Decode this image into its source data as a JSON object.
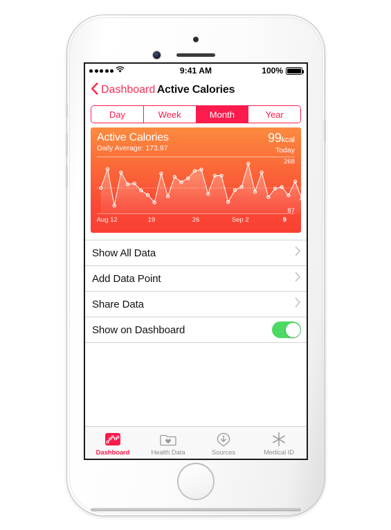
{
  "status_bar": {
    "signal_dots": 5,
    "wifi_icon": "wifi-icon",
    "time": "9:41 AM",
    "battery_percent": "100%"
  },
  "nav": {
    "back_label": "Dashboard",
    "back_icon": "chevron-left-icon",
    "title": "Active Calories"
  },
  "segmented": {
    "options": [
      "Day",
      "Week",
      "Month",
      "Year"
    ],
    "selected": "Month",
    "accent": "#fb1b4c"
  },
  "card": {
    "title": "Active Calories",
    "subtitle": "Daily Average: 173.97",
    "value": "99",
    "unit": "kcal",
    "period": "Today",
    "max_label": "268",
    "min_label": "87",
    "gradient_from": "#fb8b3f",
    "gradient_to": "#fa3f33"
  },
  "chart_data": {
    "type": "line",
    "title": "Active Calories",
    "subtitle": "Daily Average: 173.97",
    "ylabel": "kcal",
    "xlabel": "",
    "ylim": [
      87,
      268
    ],
    "grid": false,
    "legend": null,
    "average_line": 173.97,
    "axis_ticks": [
      {
        "label": "Aug 12",
        "index": 1,
        "bold": false
      },
      {
        "label": "19",
        "index": 8,
        "bold": false
      },
      {
        "label": "26",
        "index": 15,
        "bold": false
      },
      {
        "label": "Sep 2",
        "index": 22,
        "bold": false
      },
      {
        "label": "9",
        "index": 29,
        "bold": true
      }
    ],
    "tick_labels": [
      "Aug 12",
      "19",
      "26",
      "Sep 2",
      "9"
    ],
    "values": [
      174,
      245,
      108,
      232,
      188,
      191,
      165,
      148,
      120,
      228,
      143,
      216,
      196,
      210,
      238,
      243,
      152,
      220,
      220,
      122,
      166,
      178,
      265,
      160,
      232,
      140,
      172,
      178,
      147,
      198,
      133
    ]
  },
  "rows": [
    {
      "label": "Show All Data",
      "accessory": "chevron-right-icon"
    },
    {
      "label": "Add Data Point",
      "accessory": "chevron-right-icon"
    },
    {
      "label": "Share Data",
      "accessory": "chevron-right-icon"
    },
    {
      "label": "Show on Dashboard",
      "accessory": "toggle-on",
      "toggle_on": true,
      "toggle_color": "#4cd964"
    }
  ],
  "tabs": [
    {
      "label": "Dashboard",
      "icon": "dashboard-chart-icon",
      "active": true
    },
    {
      "label": "Health Data",
      "icon": "folder-heart-icon",
      "active": false
    },
    {
      "label": "Sources",
      "icon": "download-heart-icon",
      "active": false
    },
    {
      "label": "Medical ID",
      "icon": "medical-asterisk-icon",
      "active": false
    }
  ]
}
